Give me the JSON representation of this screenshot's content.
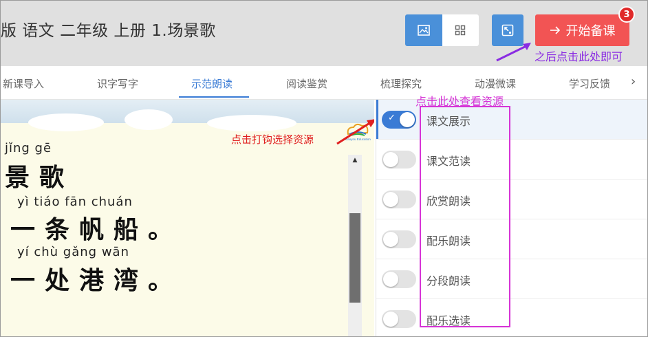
{
  "header": {
    "title": "版 语文 二年级 上册 1.场景歌",
    "start_button_label": "开始备课",
    "badge_count": "3",
    "annotation": "之后点击此处即可"
  },
  "tabs": [
    {
      "label": "新课导入",
      "active": false
    },
    {
      "label": "识字写字",
      "active": false
    },
    {
      "label": "示范朗读",
      "active": true
    },
    {
      "label": "阅读鉴赏",
      "active": false
    },
    {
      "label": "梳理探究",
      "active": false
    },
    {
      "label": "动漫微课",
      "active": false
    },
    {
      "label": "学习反馈",
      "active": false
    }
  ],
  "viewer": {
    "lines": [
      {
        "pinyin": "jǐng  gē",
        "hanzi": "景歌"
      },
      {
        "pinyin": "yì  tiáo  fān chuán",
        "hanzi": "一条帆船。"
      },
      {
        "pinyin": "yí   chù gǎng wān",
        "hanzi": "一处港湾。"
      }
    ],
    "logo_text": "Xiaoyou Education",
    "annotation": "点击打钩选择资源"
  },
  "resources": {
    "annotation": "点击此处查看资源",
    "items": [
      {
        "label": "课文展示",
        "on": true
      },
      {
        "label": "课文范读",
        "on": false
      },
      {
        "label": "欣赏朗读",
        "on": false
      },
      {
        "label": "配乐朗读",
        "on": false
      },
      {
        "label": "分段朗读",
        "on": false
      },
      {
        "label": "配乐选读",
        "on": false
      }
    ]
  },
  "colors": {
    "primary": "#4a90d9",
    "start_button": "#f25454",
    "badge": "#e02a2a",
    "active_tab": "#3a7bd5",
    "annotation_purple": "#8a2be2",
    "annotation_magenta": "#d633d6",
    "annotation_red": "#e02020"
  }
}
